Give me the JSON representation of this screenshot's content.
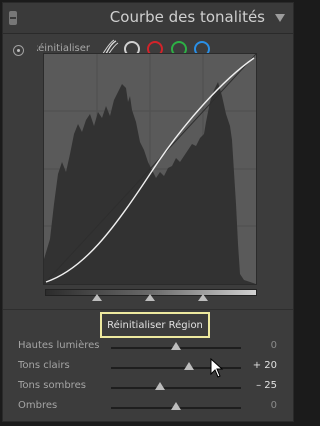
{
  "header": {
    "title": "Courbe des tonalités"
  },
  "controls": {
    "reinit_label": "Réinitialiser :",
    "channels": [
      {
        "name": "point-curve-icon",
        "color": "#d8d8d8"
      },
      {
        "name": "rgb-channel-icon",
        "color": "#d0d0d0"
      },
      {
        "name": "red-channel-icon",
        "color": "#d2232a"
      },
      {
        "name": "green-channel-icon",
        "color": "#2db045"
      },
      {
        "name": "blue-channel-icon",
        "color": "#2a8fe6"
      }
    ]
  },
  "region_button": {
    "label": "Réinitialiser Région"
  },
  "sliders": [
    {
      "label": "Hautes lumières",
      "value": "0",
      "position": 0.5
    },
    {
      "label": "Tons clairs",
      "value": "+ 20",
      "position": 0.6
    },
    {
      "label": "Tons sombres",
      "value": "– 25",
      "position": 0.38
    },
    {
      "label": "Ombres",
      "value": "0",
      "position": 0.5
    }
  ],
  "zone_splits": [
    0.25,
    0.5,
    0.75
  ],
  "colors": {
    "accent_outline": "#eeeaa0",
    "panel_bg": "#3c3c3c"
  }
}
